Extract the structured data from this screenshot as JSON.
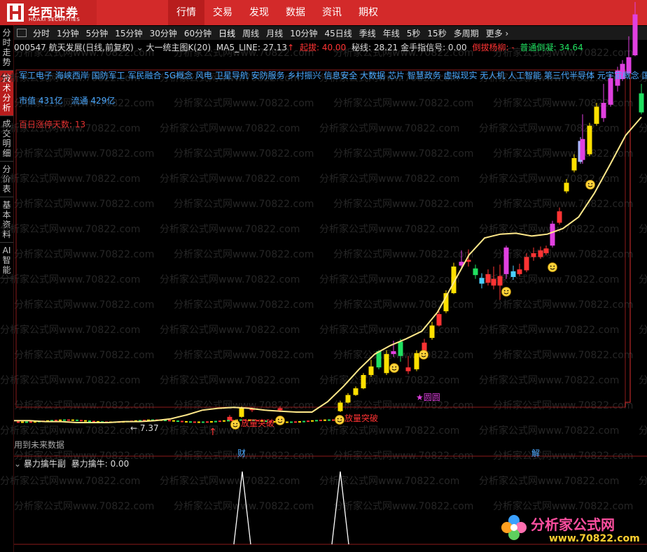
{
  "app": {
    "brand_cn": "华西证券",
    "brand_en": "HUAXI SECURITIES"
  },
  "nav": [
    "行情",
    "交易",
    "发现",
    "数据",
    "资讯",
    "期权"
  ],
  "sidebar": [
    "分时走势",
    "技术分析",
    "成交明细",
    "分价表",
    "基本资料",
    "AI智能"
  ],
  "periods": [
    "分时",
    "1分钟",
    "5分钟",
    "15分钟",
    "30分钟",
    "60分钟",
    "日线",
    "周线",
    "月线",
    "10分钟",
    "45日线",
    "季线",
    "年线",
    "5秒",
    "15秒",
    "多周期",
    "更多 ›"
  ],
  "info": {
    "stock": "000547 航天发展(日线,前复权)",
    "indicator": "大一统主图K(20)",
    "ma5": "MA5_LINE: 27.13",
    "up_arrow": "↑",
    "qibao": "起拔: 40.00",
    "secret": "秘线: 28.21",
    "golden": "金手指信号: 0.00",
    "daoba": "倒拔杨柳: -",
    "normal": "普通倒凝: 34.64"
  },
  "concepts": "军工电子 海峡西岸 国防军工 军民融合 5G概念 风电 卫星导航 安防服务 乡村振兴 信息安全 大数据 芯片 智慧政务 虚拟现实 无人机 人工智能 第三代半导体 元宇宙概念 国资",
  "cap": {
    "mv_label": "市值",
    "mv": "431亿",
    "fl_label": "流通",
    "fl": "429亿"
  },
  "limitup": "百日涨停天数: 13",
  "annotations": {
    "low_price": "← 7.37",
    "breakout1": "放量突破",
    "breakout2": "放量突破",
    "circle": "★圆圆",
    "future": "用到未来数据",
    "cai": "财",
    "jie": "解"
  },
  "sub": {
    "title": "暴力擒牛副",
    "value": "暴力擒牛: 0.00"
  },
  "watermark": {
    "text": "分析家公式网www.70822.com",
    "site_cn": "分析家公式网",
    "site_url": "www.70822.com"
  },
  "colors": {
    "up": "#ff3333",
    "down": "#20e060",
    "ma": "#ffe88a",
    "yellow_candle": "#ffe000",
    "magenta": "#e040e0"
  },
  "chart_data": {
    "type": "line",
    "title": "",
    "ma5_series": [
      7.6,
      7.6,
      7.5,
      7.5,
      7.4,
      7.4,
      7.4,
      7.5,
      7.5,
      7.6,
      7.8,
      8.2,
      8.7,
      8.9,
      9.0,
      8.9,
      8.7,
      8.6,
      8.5,
      8.5,
      9.6,
      11.2,
      13.0,
      14.6,
      15.5,
      16.2,
      17.0,
      19.0,
      22.0,
      25.0,
      26.8,
      27.2,
      27.3,
      27.0,
      27.2,
      27.8,
      29.0,
      31.5,
      34.5,
      37.6,
      39.5
    ]
  }
}
